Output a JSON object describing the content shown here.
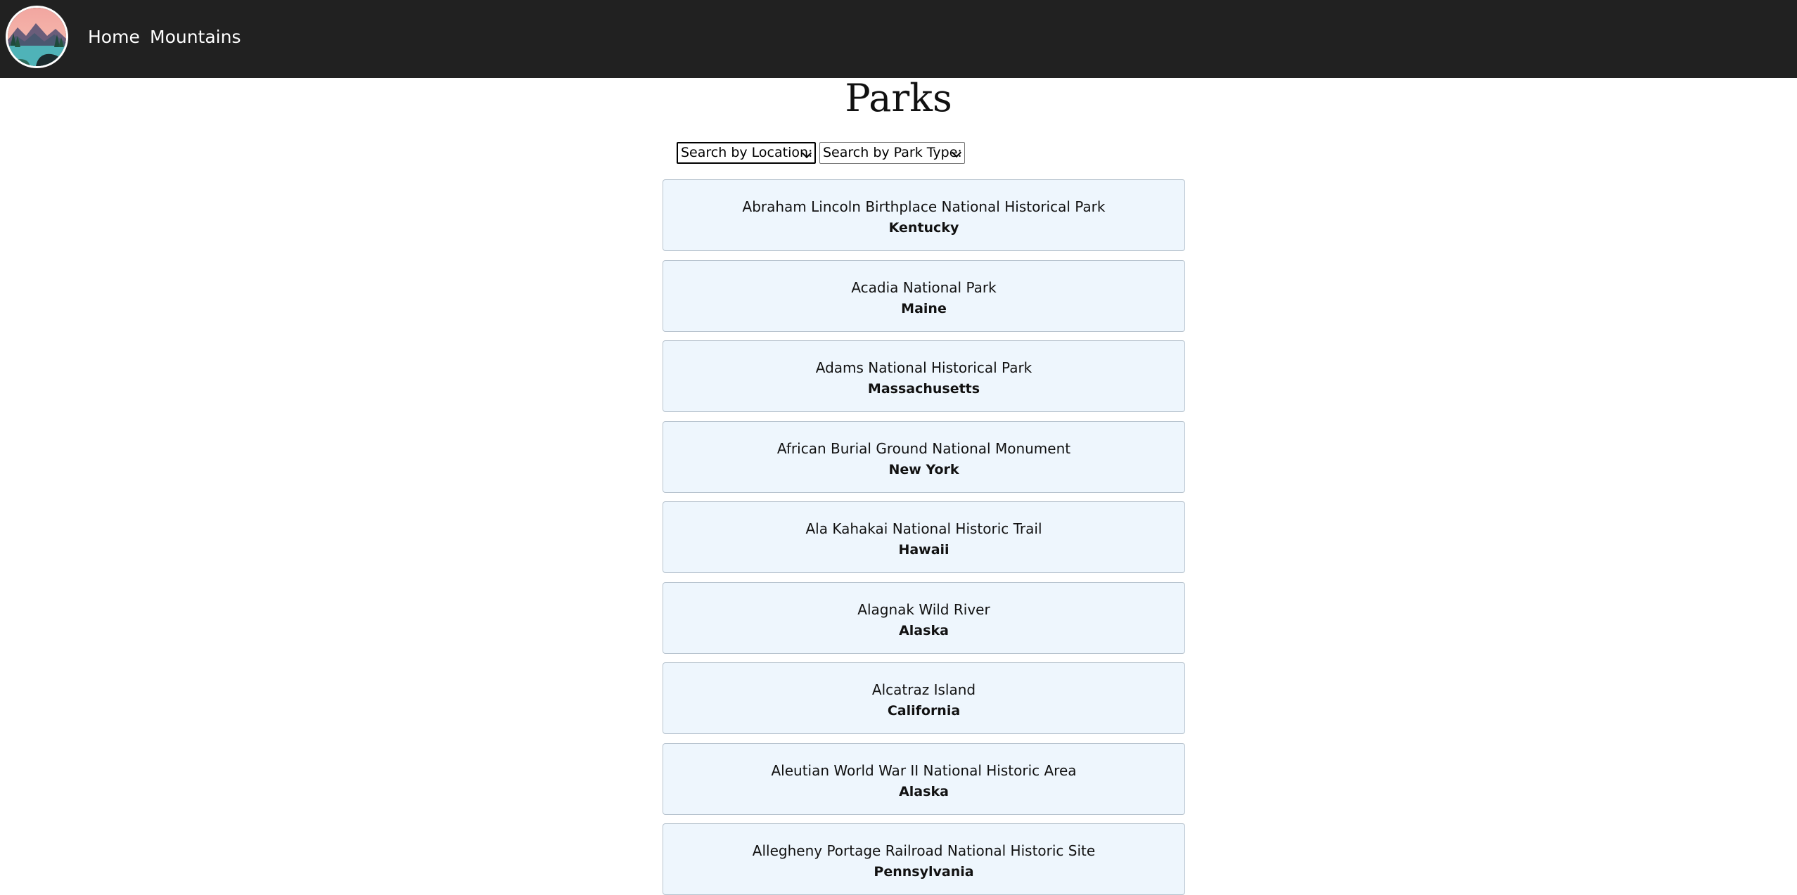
{
  "nav": {
    "logo_icon": "mountain-lake-logo-icon",
    "home_label": "Home",
    "mountains_label": "Mountains",
    "background": "#212121"
  },
  "page": {
    "title": "Parks"
  },
  "filters": {
    "location_selected": "Search by Location:",
    "park_type_selected": "Search by Park Type:"
  },
  "parks": [
    {
      "name": "Abraham Lincoln Birthplace National Historical Park",
      "state": "Kentucky"
    },
    {
      "name": "Acadia National Park",
      "state": "Maine"
    },
    {
      "name": "Adams National Historical Park",
      "state": "Massachusetts"
    },
    {
      "name": "African Burial Ground National Monument",
      "state": "New York"
    },
    {
      "name": "Ala Kahakai National Historic Trail",
      "state": "Hawaii"
    },
    {
      "name": "Alagnak Wild River",
      "state": "Alaska"
    },
    {
      "name": "Alcatraz Island",
      "state": "California"
    },
    {
      "name": "Aleutian World War II National Historic Area",
      "state": "Alaska"
    },
    {
      "name": "Allegheny Portage Railroad National Historic Site",
      "state": "Pennsylvania"
    }
  ],
  "colors": {
    "card_background": "#eef6fd",
    "card_border": "#b8c4cf"
  }
}
